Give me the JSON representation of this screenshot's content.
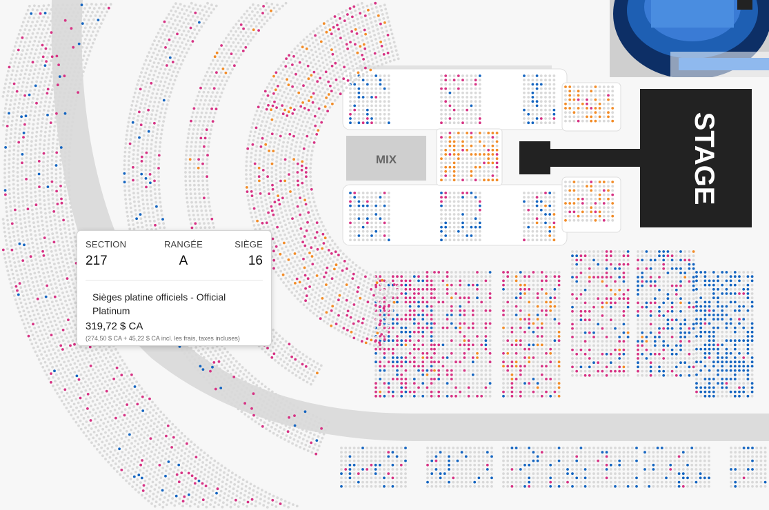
{
  "stage_label": "STAGE",
  "mix_label": "MIX",
  "tooltip": {
    "section_label": "SECTION",
    "row_label": "RANGÉE",
    "seat_label": "SIÈGE",
    "section_value": "217",
    "row_value": "A",
    "seat_value": "16",
    "description": "Sièges platine officiels - Official Platinum",
    "price": "319,72 $ CA",
    "price_note": "(274,50 $ CA + 45,22 $ CA incl. les frais, taxes incluses)"
  },
  "seat_colors": {
    "unavailable": "#d9d9d9",
    "platinum": "#d63384",
    "standard": "#1565c0",
    "resale": "#f28c28",
    "light_pink": "#f3a6c8"
  },
  "ui_colors": {
    "background": "#f7f7f7",
    "concourse": "#dcdcdc",
    "section_fill": "#ffffff",
    "stage_fill": "#222222",
    "mix_fill": "#cfcfcf",
    "minimap_blue": "#1e5fb3"
  }
}
